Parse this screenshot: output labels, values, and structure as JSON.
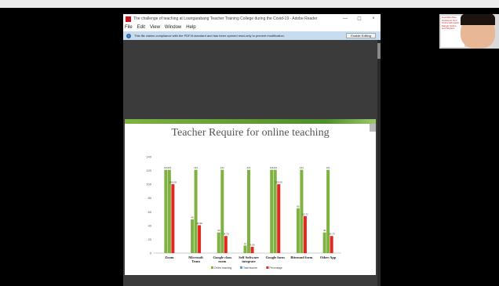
{
  "window": {
    "title": "The challenge of teaching at Loungarabang Teacher Training College during the Covid-19 - Adobe Reader",
    "min": "—",
    "max": "☐",
    "close": "×"
  },
  "menu": [
    "File",
    "Edit",
    "View",
    "Window",
    "Help"
  ],
  "notice": {
    "text": "This file claims compliance with the PDF/A standard and has been opened read-only to prevent modification.",
    "button": "Enable Editing"
  },
  "camera": {
    "slide_lines": [
      "Australia Alive",
      "Academic Tour",
      "Online Education",
      "Margin Online",
      "and Student"
    ]
  },
  "colors": {
    "online": "#7fb241",
    "total": "#5b9bd5",
    "percentage": "#e5261f"
  },
  "chart_data": {
    "type": "bar",
    "title": "Teacher Require for online teaching",
    "categories": [
      "Zoom",
      "Microsoft Team",
      "Google class room",
      "Self Software integrate",
      "Google form",
      "Bitround form",
      "Other App"
    ],
    "ylim": [
      0,
      140
    ],
    "yticks": [
      0,
      20,
      40,
      60,
      80,
      100,
      120,
      140
    ],
    "series": [
      {
        "name": "Online teaching",
        "values": [
          121,
          49,
          30,
          11,
          121,
          65,
          30
        ]
      },
      {
        "name": "Total teacher",
        "values": [
          121,
          121,
          121,
          121,
          121,
          121,
          121
        ]
      },
      {
        "name": "Percentage",
        "values": [
          100.0,
          40.5,
          24.79,
          9.09,
          100.0,
          53.72,
          24.79
        ]
      }
    ],
    "value_labels": [
      [
        "121",
        "121",
        "100.00"
      ],
      [
        "49",
        "121",
        "40.50"
      ],
      [
        "30",
        "121",
        "24.79"
      ],
      [
        "11",
        "121",
        "9.09"
      ],
      [
        "121",
        "121",
        "100.00"
      ],
      [
        "65",
        "121",
        "53.72"
      ],
      [
        "30",
        "121",
        "24.79"
      ]
    ],
    "legend": [
      "Online teaching",
      "Total teacher",
      "Percentage"
    ],
    "legend_position": "bottom",
    "grid": false
  }
}
